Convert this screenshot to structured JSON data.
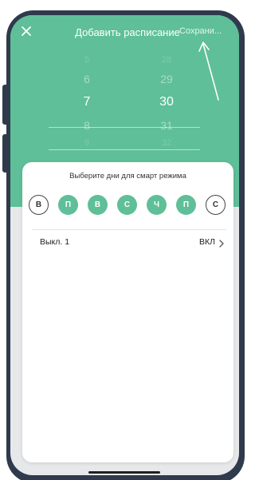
{
  "header": {
    "title": "Добавить расписание",
    "save_label": "Сохрани..."
  },
  "picker": {
    "hours": [
      "5",
      "6",
      "7",
      "8",
      "9"
    ],
    "minutes": [
      "28",
      "29",
      "30",
      "31",
      "32"
    ],
    "selected_hour": "7",
    "selected_minute": "30"
  },
  "card": {
    "title": "Выберите дни для смарт режима",
    "days": [
      {
        "label": "В",
        "active": false
      },
      {
        "label": "П",
        "active": true
      },
      {
        "label": "В",
        "active": true
      },
      {
        "label": "С",
        "active": true
      },
      {
        "label": "Ч",
        "active": true
      },
      {
        "label": "П",
        "active": true
      },
      {
        "label": "С",
        "active": false
      }
    ],
    "setting": {
      "label": "Выкл. 1",
      "value": "ВКЛ"
    }
  },
  "colors": {
    "accent": "#5fbf98",
    "phone_frame": "#2f3a4c",
    "background": "#e7e8ea"
  },
  "icons": {
    "close": "close-icon",
    "chevron": "chevron-right-icon"
  }
}
